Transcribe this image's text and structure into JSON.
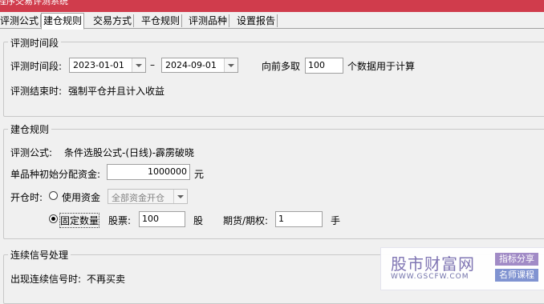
{
  "window": {
    "title": "程序交易评测系统"
  },
  "tabs": [
    {
      "label": "评测公式"
    },
    {
      "label": "建仓规则"
    },
    {
      "label": "交易方式"
    },
    {
      "label": "平仓规则"
    },
    {
      "label": "评测品种"
    },
    {
      "label": "设置报告"
    }
  ],
  "period": {
    "legend": "评测时间段",
    "label": "评测时间段:",
    "start_date": "2023-01-01",
    "dash": "–",
    "end_date": "2024-09-01",
    "lookback_label": "向前多取",
    "lookback_value": "100",
    "lookback_suffix": "个数据用于计算",
    "end_label": "评测结束时:",
    "end_value": "强制平仓并且计入收益"
  },
  "entry": {
    "legend": "建仓规则",
    "formula_label": "评测公式:",
    "formula_value": "条件选股公式-(日线)-霹雳破晓",
    "capital_label": "单品种初始分配资金:",
    "capital_value": "1000000",
    "capital_unit": "元",
    "open_label": "开仓时:",
    "use_funds_label": "使用资金",
    "use_funds_option": "全部资金开仓",
    "fixed_qty_label": "固定数量",
    "stock_label": "股票:",
    "stock_value": "100",
    "stock_unit": "股",
    "futures_label": "期货/期权:",
    "futures_value": "1",
    "futures_unit": "手"
  },
  "signals": {
    "legend": "连续信号处理",
    "label": "出现连续信号时:",
    "value": "不再买卖"
  },
  "watermark": {
    "logo": "股市财富网",
    "url": "WWW.GSCFW.COM",
    "tag1": "指标分享",
    "tag2": "名师课程"
  }
}
